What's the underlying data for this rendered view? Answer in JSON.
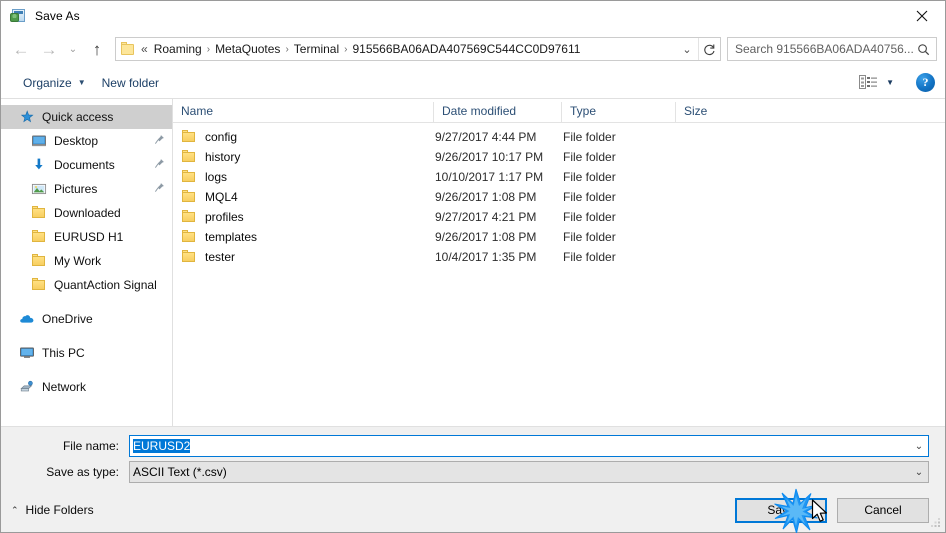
{
  "window": {
    "title": "Save As",
    "icon": "save-as-icon",
    "close_label": "✕"
  },
  "nav": {
    "back": "←",
    "forward": "→",
    "recent": "⌄",
    "up": "↑",
    "breadcrumb_overflow": "«",
    "breadcrumbs": [
      {
        "label": "Roaming"
      },
      {
        "label": "MetaQuotes"
      },
      {
        "label": "Terminal"
      },
      {
        "label": "915566BA06ADA407569C544CC0D97611"
      }
    ],
    "separator": "›",
    "dropdown": "⌄",
    "refresh": "↻"
  },
  "search": {
    "placeholder": "Search 915566BA06ADA40756...",
    "icon": "search-icon"
  },
  "toolbar": {
    "organize": "Organize",
    "organize_caret": "▼",
    "new_folder": "New folder",
    "view_icon": "list-view-icon",
    "view_caret": "▼",
    "help": "?"
  },
  "sidebar": {
    "items": [
      {
        "label": "Quick access",
        "icon": "star-icon",
        "level": 1,
        "selected": true,
        "pinned": false
      },
      {
        "label": "Desktop",
        "icon": "desktop-icon",
        "level": 2,
        "selected": false,
        "pinned": true
      },
      {
        "label": "Documents",
        "icon": "documents-icon",
        "level": 2,
        "selected": false,
        "pinned": true
      },
      {
        "label": "Pictures",
        "icon": "pictures-icon",
        "level": 2,
        "selected": false,
        "pinned": true
      },
      {
        "label": "Downloaded",
        "icon": "folder-icon",
        "level": 2,
        "selected": false,
        "pinned": false
      },
      {
        "label": "EURUSD H1",
        "icon": "folder-icon",
        "level": 2,
        "selected": false,
        "pinned": false
      },
      {
        "label": "My Work",
        "icon": "folder-icon",
        "level": 2,
        "selected": false,
        "pinned": false
      },
      {
        "label": "QuantAction Signal",
        "icon": "folder-icon",
        "level": 2,
        "selected": false,
        "pinned": false
      },
      {
        "label": "OneDrive",
        "icon": "onedrive-icon",
        "level": 1,
        "selected": false,
        "pinned": false,
        "gap_before": true
      },
      {
        "label": "This PC",
        "icon": "this-pc-icon",
        "level": 1,
        "selected": false,
        "pinned": false,
        "gap_before": true
      },
      {
        "label": "Network",
        "icon": "network-icon",
        "level": 1,
        "selected": false,
        "pinned": false,
        "gap_before": true
      }
    ]
  },
  "filelist": {
    "columns": [
      "Name",
      "Date modified",
      "Type",
      "Size"
    ],
    "sort_column": "Name",
    "sort_caret": "⌃",
    "rows": [
      {
        "name": "config",
        "date": "9/27/2017 4:44 PM",
        "type": "File folder",
        "size": ""
      },
      {
        "name": "history",
        "date": "9/26/2017 10:17 PM",
        "type": "File folder",
        "size": ""
      },
      {
        "name": "logs",
        "date": "10/10/2017 1:17 PM",
        "type": "File folder",
        "size": ""
      },
      {
        "name": "MQL4",
        "date": "9/26/2017 1:08 PM",
        "type": "File folder",
        "size": ""
      },
      {
        "name": "profiles",
        "date": "9/27/2017 4:21 PM",
        "type": "File folder",
        "size": ""
      },
      {
        "name": "templates",
        "date": "9/26/2017 1:08 PM",
        "type": "File folder",
        "size": ""
      },
      {
        "name": "tester",
        "date": "10/4/2017 1:35 PM",
        "type": "File folder",
        "size": ""
      }
    ]
  },
  "form": {
    "filename_label": "File name:",
    "filename_value": "EURUSD2",
    "filetype_label": "Save as type:",
    "filetype_value": "ASCII Text (*.csv)",
    "chevron": "⌄"
  },
  "footer": {
    "hide_folders": "Hide Folders",
    "hide_caret": "⌃",
    "save": "Save",
    "cancel": "Cancel"
  },
  "colors": {
    "accent": "#0078d7",
    "selection": "#0078d7",
    "sidebar_selected": "#cfcfcf",
    "folder": "#ffe082",
    "chrome": "#f0f0f0",
    "crumb_text": "#1a1a1a"
  }
}
